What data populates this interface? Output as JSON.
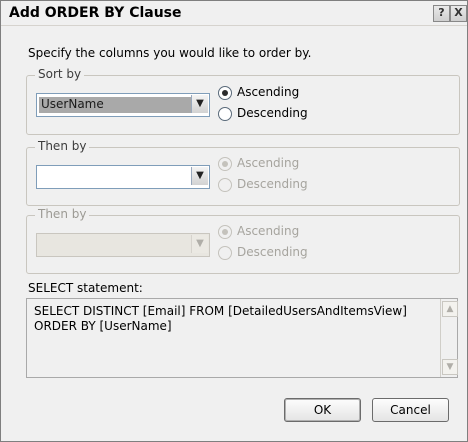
{
  "window": {
    "title": "Add ORDER BY Clause",
    "help_icon": "?",
    "close_icon": "X"
  },
  "instruction": "Specify the columns you would like to order by.",
  "groups": [
    {
      "label": "Sort by",
      "combo_value": "UserName",
      "radios": [
        {
          "label": "Ascending",
          "checked": true
        },
        {
          "label": "Descending",
          "checked": false
        }
      ],
      "enabled": true
    },
    {
      "label": "Then by",
      "combo_value": "",
      "radios": [
        {
          "label": "Ascending",
          "checked": true
        },
        {
          "label": "Descending",
          "checked": false
        }
      ],
      "enabled": true,
      "radios_enabled": false
    },
    {
      "label": "Then by",
      "combo_value": "",
      "radios": [
        {
          "label": "Ascending",
          "checked": true
        },
        {
          "label": "Descending",
          "checked": false
        }
      ],
      "enabled": false
    }
  ],
  "select_statement": {
    "label": "SELECT statement:",
    "text": "SELECT DISTINCT [Email] FROM [DetailedUsersAndItemsView] ORDER BY [UserName]"
  },
  "buttons": {
    "ok": "OK",
    "cancel": "Cancel"
  }
}
